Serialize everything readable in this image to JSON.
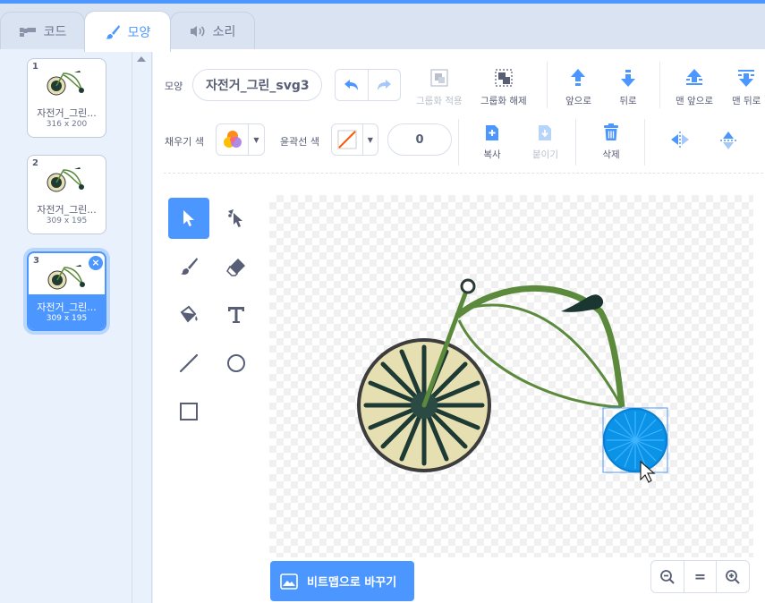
{
  "tabs": {
    "code": "코드",
    "costume": "모양",
    "sound": "소리"
  },
  "costumes": [
    {
      "num": "1",
      "name": "자전거_그린...",
      "size": "316 x 200"
    },
    {
      "num": "2",
      "name": "자전거_그린...",
      "size": "309 x 195"
    },
    {
      "num": "3",
      "name": "자전거_그린...",
      "size": "309 x 195"
    }
  ],
  "toolbar": {
    "costume_label": "모양",
    "costume_name": "자전거_그린_svg3",
    "group": "그룹화 적용",
    "ungroup": "그룹화 해제",
    "forward": "앞으로",
    "backward": "뒤로",
    "front": "맨 앞으로",
    "back": "맨 뒤로",
    "fill_label": "채우기 색",
    "outline_label": "윤곽선 색",
    "outline_width": "0",
    "copy": "복사",
    "paste": "붙이기",
    "delete": "삭제"
  },
  "bottom": {
    "bitmap_button": "비트맵으로 바꾸기",
    "zoom_reset": "="
  },
  "colors": {
    "accent": "#4c97ff",
    "tab_bg": "#d9e3f2",
    "panel_bg": "#e9f1fc"
  }
}
